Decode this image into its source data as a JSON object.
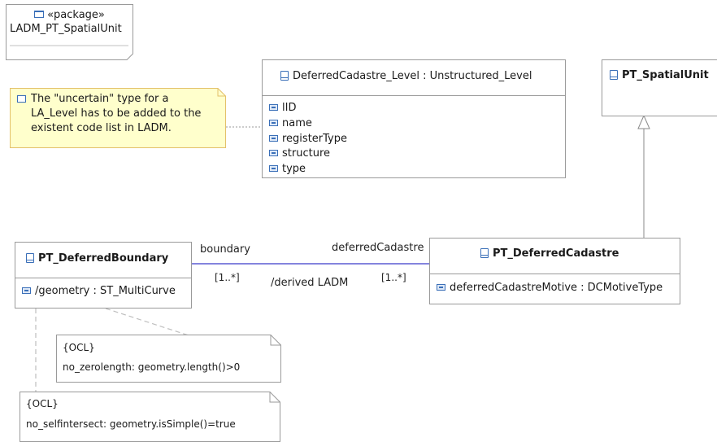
{
  "package": {
    "stereotype": "«package»",
    "name": "LADM_PT_SpatialUnit"
  },
  "note_uncertain": {
    "lines": [
      "The \"uncertain\" type for a",
      "LA_Level has to be added to the",
      "existent code list in LADM."
    ]
  },
  "deferred_level": {
    "title": "DeferredCadastre_Level : Unstructured_Level",
    "attributes": [
      "lID",
      "name",
      "registerType",
      "structure",
      "type"
    ]
  },
  "spatial_unit": {
    "title": "PT_SpatialUnit"
  },
  "deferred_boundary": {
    "title": "PT_DeferredBoundary",
    "attribute": "/geometry : ST_MultiCurve"
  },
  "deferred_cadastre": {
    "title": "PT_DeferredCadastre",
    "attribute": "deferredCadastreMotive : DCMotiveType"
  },
  "association": {
    "left_role": "boundary",
    "left_mult": "[1..*]",
    "right_role": "deferredCadastre",
    "right_mult": "[1..*]",
    "name": "/derived LADM"
  },
  "ocl_zero": {
    "tag": "{OCL}",
    "text": "no_zerolength: geometry.length()>0"
  },
  "ocl_simple": {
    "tag": "{OCL}",
    "text": "no_selfintersect: geometry.isSimple()=true"
  },
  "colors": {
    "association_line": "#3b3bc9",
    "note_fill": "#ffffcc",
    "note_border": "#e3c16a",
    "icon_blue": "#3a6fb8"
  }
}
